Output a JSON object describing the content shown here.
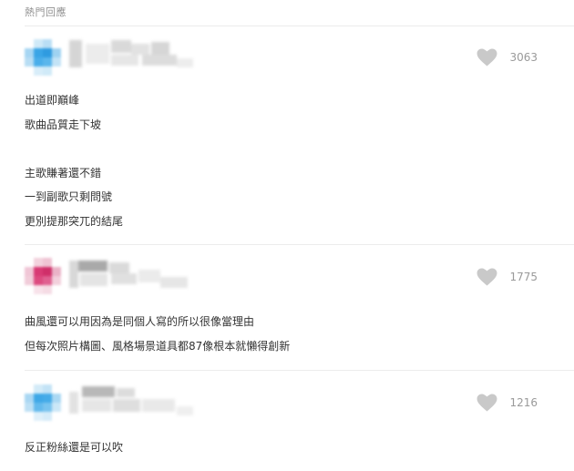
{
  "section": {
    "title": "熱門回應"
  },
  "colors": {
    "divider": "#ececec",
    "heart": "#c9c9c9",
    "count": "#9a9a9a",
    "text": "#333333"
  },
  "comments": [
    {
      "avatar": "blurred-blue-avatar",
      "username_blurred": true,
      "likes": "3063",
      "lines": [
        "出道即巔峰",
        "歌曲品質走下坡",
        "",
        "主歌賺著還不錯",
        "一到副歌只剩問號",
        "更別提那突兀的結尾"
      ]
    },
    {
      "avatar": "blurred-pink-avatar",
      "username_blurred": true,
      "likes": "1775",
      "lines": [
        "曲風還可以用因為是同個人寫的所以很像當理由",
        "但每次照片構圖、風格場景道具都87像根本就懶得創新"
      ]
    },
    {
      "avatar": "blurred-blue-avatar",
      "username_blurred": true,
      "likes": "1216",
      "lines": [
        "反正粉絲還是可以吹"
      ]
    }
  ]
}
